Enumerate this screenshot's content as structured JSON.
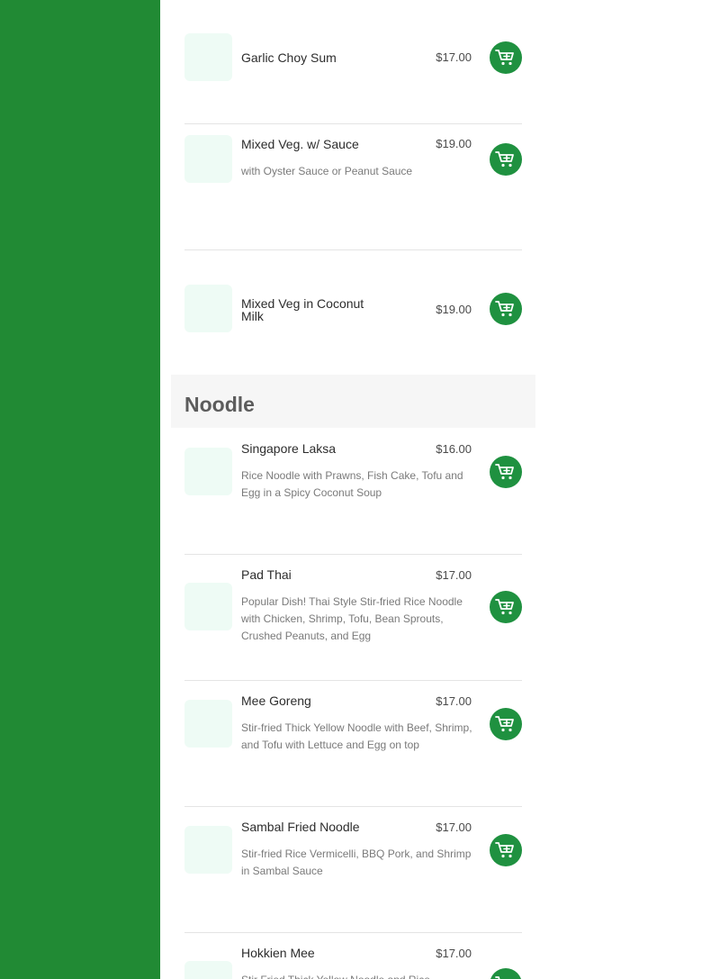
{
  "colors": {
    "sidebar": "#218a34",
    "cart_button": "#1f9140",
    "thumb": "#eefbf5"
  },
  "icons": {
    "cart": "cart-add-icon"
  },
  "sections": [
    {
      "title": "",
      "items": [
        {
          "name": "Garlic Choy Sum",
          "price": "$17.00",
          "desc": ""
        },
        {
          "name": "Mixed Veg. w/ Sauce",
          "price": "$19.00",
          "desc": "with Oyster Sauce or Peanut Sauce"
        },
        {
          "name": "Mixed Veg in Coconut Milk",
          "price": "$19.00",
          "desc": ""
        }
      ]
    },
    {
      "title": "Noodle",
      "items": [
        {
          "name": "Singapore Laksa",
          "price": "$16.00",
          "desc": "Rice Noodle with Prawns, Fish Cake, Tofu and Egg in a Spicy Coconut Soup"
        },
        {
          "name": "Pad Thai",
          "price": "$17.00",
          "desc": "Popular Dish! Thai Style Stir-fried Rice Noodle with Chicken, Shrimp, Tofu, Bean Sprouts, Crushed Peanuts, and Egg"
        },
        {
          "name": "Mee Goreng",
          "price": "$17.00",
          "desc": "Stir-fried Thick Yellow Noodle with Beef, Shrimp, and Tofu with Lettuce and Egg on top"
        },
        {
          "name": "Sambal Fried Noodle",
          "price": "$17.00",
          "desc": "Stir-fried Rice Vermicelli, BBQ Pork, and Shrimp in Sambal Sauce"
        },
        {
          "name": "Hokkien Mee",
          "price": "$17.00",
          "desc": "Stir Fried Thick Yellow Noodle and Rice"
        }
      ]
    }
  ]
}
